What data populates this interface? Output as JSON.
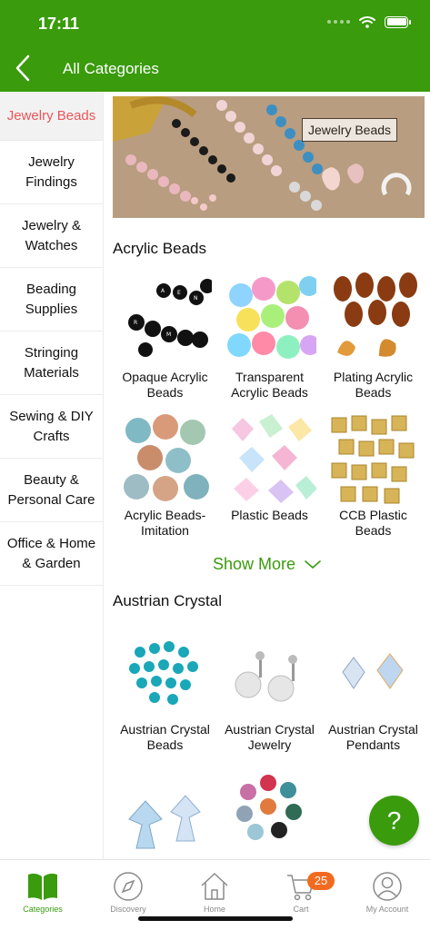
{
  "status_bar": {
    "time": "17:11"
  },
  "header": {
    "title": "All Categories",
    "back_icon": "chevron-left-icon"
  },
  "sidebar": {
    "items": [
      {
        "label": "Jewelry Beads",
        "active": true
      },
      {
        "label": "Jewelry Findings",
        "active": false
      },
      {
        "label": "Jewelry & Watches",
        "active": false
      },
      {
        "label": "Beading Supplies",
        "active": false
      },
      {
        "label": "Stringing Materials",
        "active": false
      },
      {
        "label": "Sewing & DIY Crafts",
        "active": false
      },
      {
        "label": "Beauty & Personal Care",
        "active": false
      },
      {
        "label": "Office & Home & Garden",
        "active": false
      }
    ]
  },
  "banner": {
    "label": "Jewelry Beads"
  },
  "sections": [
    {
      "title": "Acrylic Beads",
      "items": [
        {
          "label": "Opaque Acrylic Beads"
        },
        {
          "label": "Transparent Acrylic Beads"
        },
        {
          "label": "Plating Acrylic Beads"
        },
        {
          "label": "Acrylic Beads-Imitation"
        },
        {
          "label": "Plastic Beads"
        },
        {
          "label": "CCB Plastic Beads"
        }
      ],
      "show_more": "Show More"
    },
    {
      "title": "Austrian Crystal",
      "items": [
        {
          "label": "Austrian Crystal Beads"
        },
        {
          "label": "Austrian Crystal Jewelry"
        },
        {
          "label": "Austrian Crystal Pendants"
        },
        {
          "label": ""
        },
        {
          "label": ""
        }
      ]
    }
  ],
  "help_button": {
    "label": "?"
  },
  "tabbar": {
    "tabs": [
      {
        "label": "Categories",
        "icon": "book-icon",
        "active": true
      },
      {
        "label": "Discovery",
        "icon": "compass-icon",
        "active": false
      },
      {
        "label": "Home",
        "icon": "house-icon",
        "active": false
      },
      {
        "label": "Cart",
        "icon": "cart-icon",
        "active": false
      },
      {
        "label": "My Account",
        "icon": "user-icon",
        "active": false
      }
    ],
    "cart_count": "25"
  },
  "colors": {
    "brand": "#3a9b0d",
    "active_text": "#e8565a",
    "badge": "#f26a1f"
  }
}
